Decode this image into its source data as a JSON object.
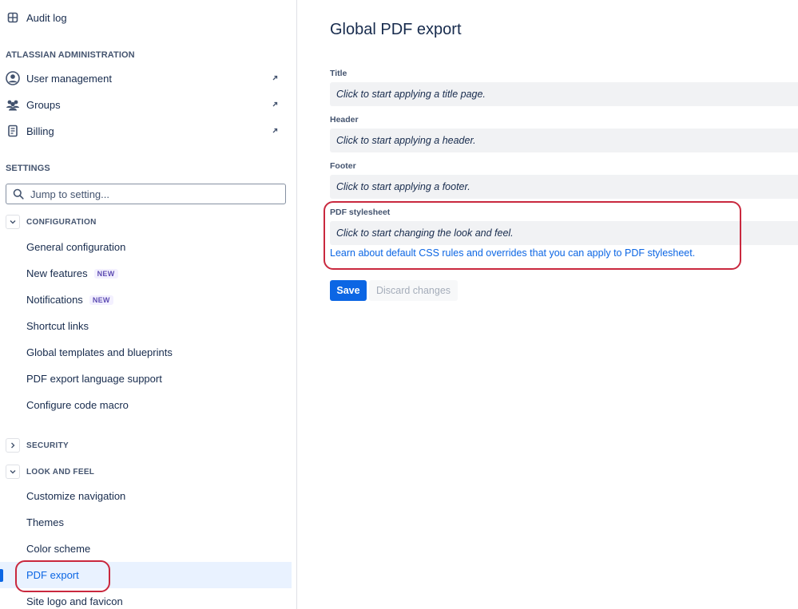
{
  "sidebar": {
    "audit_log": {
      "label": "Audit log",
      "icon": "grid-icon"
    },
    "atlassian_admin_heading": "ATLASSIAN ADMINISTRATION",
    "admin_items": [
      {
        "label": "User management",
        "icon": "person-icon",
        "external": true
      },
      {
        "label": "Groups",
        "icon": "people-icon",
        "external": true
      },
      {
        "label": "Billing",
        "icon": "receipt-icon",
        "external": true
      }
    ],
    "settings_heading": "SETTINGS",
    "search": {
      "placeholder": "Jump to setting..."
    },
    "configuration": {
      "heading": "CONFIGURATION",
      "expanded": true,
      "items": [
        {
          "label": "General configuration"
        },
        {
          "label": "New features",
          "badge": "NEW"
        },
        {
          "label": "Notifications",
          "badge": "NEW"
        },
        {
          "label": "Shortcut links"
        },
        {
          "label": "Global templates and blueprints"
        },
        {
          "label": "PDF export language support"
        },
        {
          "label": "Configure code macro"
        }
      ]
    },
    "security": {
      "heading": "SECURITY",
      "expanded": false
    },
    "look_and_feel": {
      "heading": "LOOK AND FEEL",
      "expanded": true,
      "items": [
        {
          "label": "Customize navigation"
        },
        {
          "label": "Themes"
        },
        {
          "label": "Color scheme"
        },
        {
          "label": "PDF export",
          "selected": true
        },
        {
          "label": "Site logo and favicon"
        }
      ]
    }
  },
  "main": {
    "title": "Global PDF export",
    "fields": [
      {
        "label": "Title",
        "placeholder": "Click to start applying a title page."
      },
      {
        "label": "Header",
        "placeholder": "Click to start applying a header."
      },
      {
        "label": "Footer",
        "placeholder": "Click to start applying a footer."
      },
      {
        "label": "PDF stylesheet",
        "placeholder": "Click to start changing the look and feel."
      }
    ],
    "stylesheet_link": "Learn about default CSS rules and overrides that you can apply to PDF stylesheet.",
    "save_label": "Save",
    "discard_label": "Discard changes"
  },
  "colors": {
    "accent": "#0c66e4",
    "highlight": "#c9283e",
    "badge_text": "#5e4db2",
    "field_bg": "#f1f2f4"
  }
}
